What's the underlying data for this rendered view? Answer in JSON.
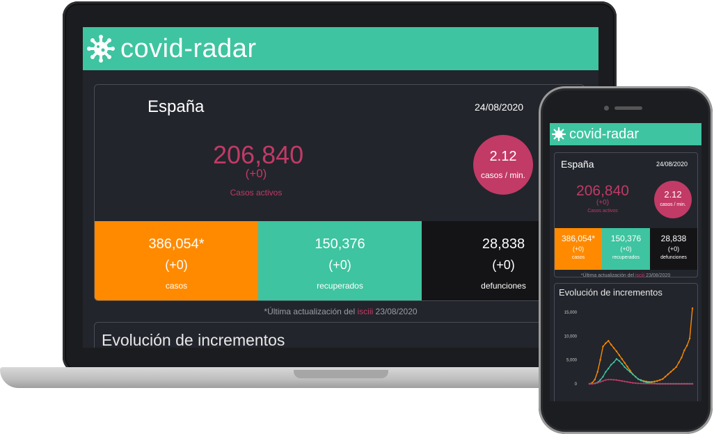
{
  "brand": "covid-radar",
  "summary": {
    "country": "España",
    "date": "24/08/2020",
    "active_value": "206,840",
    "active_delta": "(+0)",
    "active_label": "Casos activos",
    "rate_value": "2.12",
    "rate_label": "casos / min.",
    "stats": [
      {
        "value": "386,054*",
        "delta": "(+0)",
        "label": "casos"
      },
      {
        "value": "150,376",
        "delta": "(+0)",
        "label": "recuperados"
      },
      {
        "value": "28,838",
        "delta": "(+0)",
        "label": "defunciones"
      }
    ],
    "update_prefix": "*Última actualización del",
    "update_source": "isciii",
    "update_date": "23/08/2020"
  },
  "evolution": {
    "title": "Evolución de incrementos"
  },
  "colors": {
    "accent": "#3ec4a0",
    "active": "#c23a66",
    "cases": "#ff8a00",
    "deaths_bg": "#141416",
    "background": "#22252c"
  },
  "chart_data": {
    "type": "line",
    "title": "Evolución de incrementos",
    "ylim": [
      0,
      16000
    ],
    "yticks": [
      "15,000",
      "10,000",
      "5,000",
      "0"
    ],
    "ytick_values": [
      15000,
      10000,
      5000,
      0
    ],
    "series": [
      {
        "color": "#ff8a00",
        "values": [
          0,
          200,
          900,
          2500,
          5000,
          7800,
          8500,
          9000,
          8200,
          7500,
          6800,
          6000,
          5200,
          4400,
          3600,
          2800,
          2000,
          1500,
          1000,
          800,
          600,
          500,
          400,
          400,
          500,
          600,
          800,
          1000,
          1500,
          2000,
          2500,
          3000,
          3500,
          4500,
          5500,
          7000,
          8000,
          9500,
          15800
        ]
      },
      {
        "color": "#3ec4a0",
        "values": [
          0,
          0,
          100,
          300,
          800,
          1500,
          2500,
          3200,
          4000,
          4500,
          5200,
          4800,
          4200,
          3500,
          3000,
          2500,
          2000,
          1500,
          1000,
          700,
          500,
          300,
          200,
          100,
          100,
          0,
          0,
          0,
          0,
          0,
          0,
          0,
          0,
          0,
          0,
          0,
          0,
          0,
          0
        ]
      },
      {
        "color": "#c23a66",
        "values": [
          0,
          0,
          50,
          200,
          400,
          600,
          800,
          900,
          900,
          850,
          800,
          700,
          600,
          500,
          400,
          300,
          200,
          150,
          100,
          80,
          60,
          50,
          40,
          30,
          20,
          20,
          20,
          20,
          20,
          20,
          20,
          20,
          20,
          20,
          20,
          20,
          20,
          20,
          20
        ]
      }
    ]
  }
}
